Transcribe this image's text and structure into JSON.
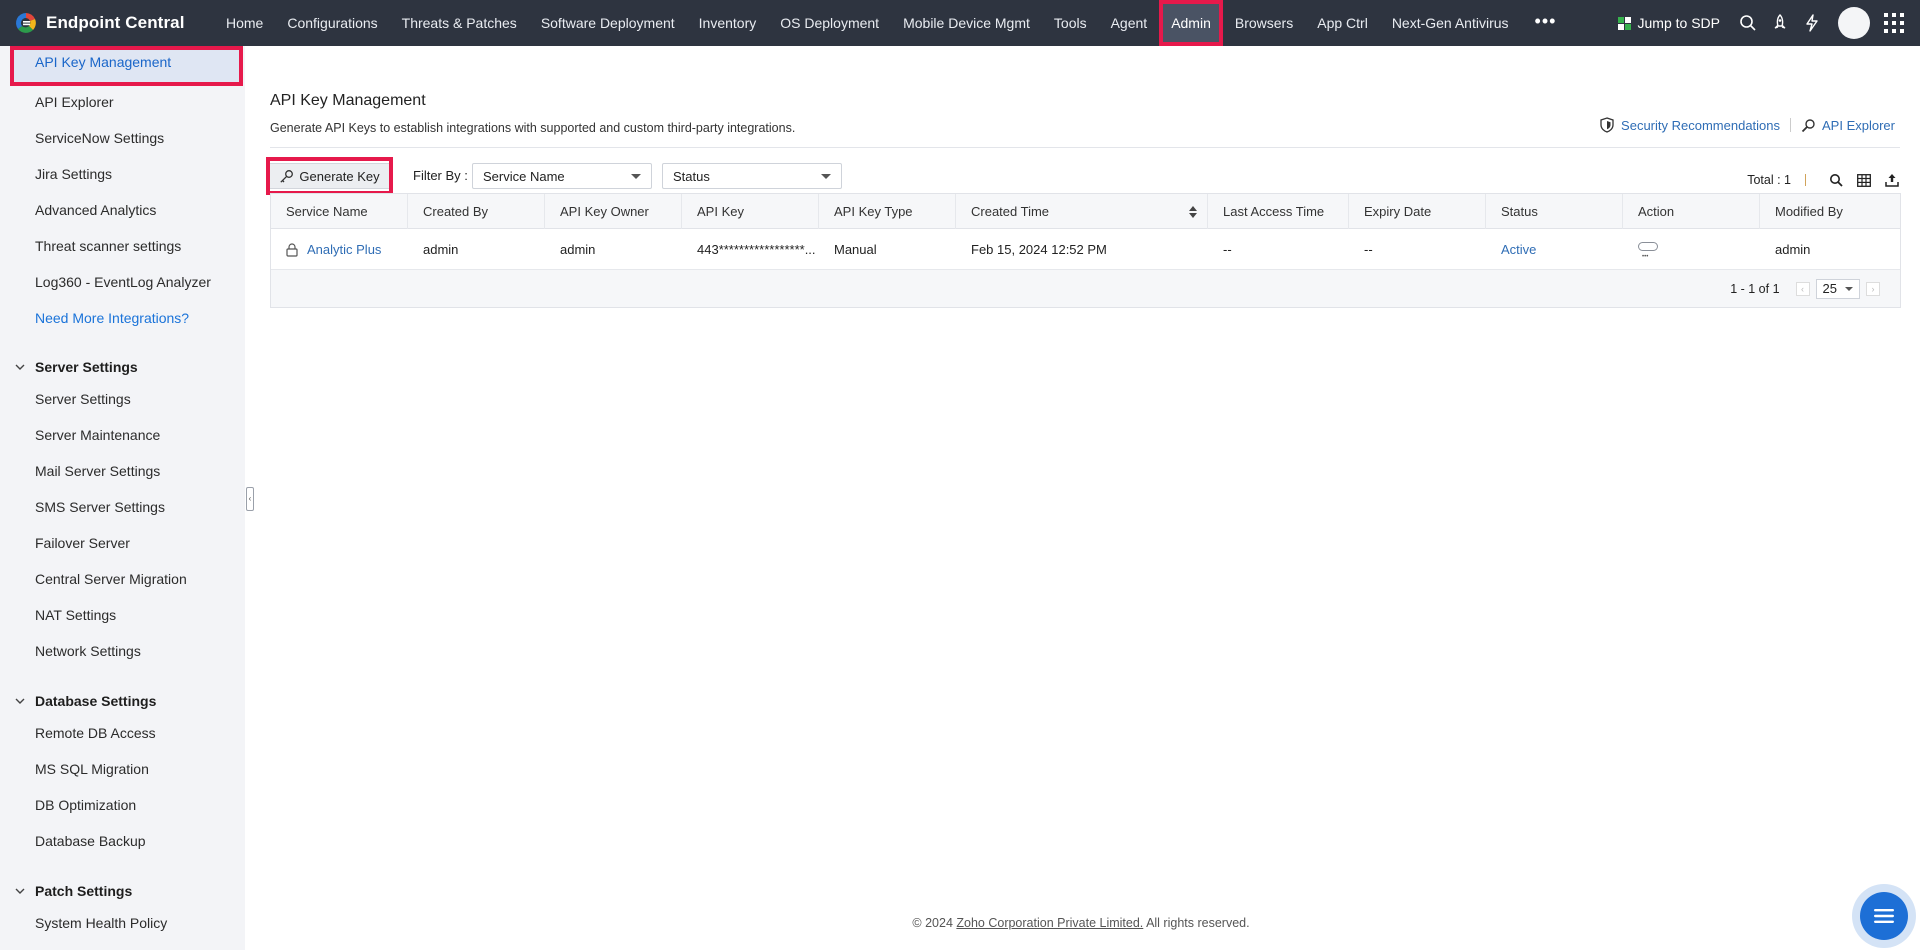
{
  "app": {
    "brand": "Endpoint Central"
  },
  "nav": {
    "items": [
      "Home",
      "Configurations",
      "Threats & Patches",
      "Software Deployment",
      "Inventory",
      "OS Deployment",
      "Mobile Device Mgmt",
      "Tools",
      "Agent",
      "Admin",
      "Browsers",
      "App Ctrl",
      "Next-Gen Antivirus"
    ],
    "active": "Admin",
    "more_icon": "more-horizontal-icon",
    "jump_label": "Jump to SDP",
    "right_icons": [
      "search-icon",
      "rocket-icon",
      "lightning-icon",
      "avatar",
      "apps-grid-icon"
    ]
  },
  "sidebar": {
    "integrations": [
      "API Key Management",
      "API Explorer",
      "ServiceNow Settings",
      "Jira Settings",
      "Advanced Analytics",
      "Threat scanner settings",
      "Log360 - EventLog Analyzer"
    ],
    "need_more": "Need More Integrations?",
    "sections": [
      {
        "title": "Server Settings",
        "items": [
          "Server Settings",
          "Server Maintenance",
          "Mail Server Settings",
          "SMS Server Settings",
          "Failover Server",
          "Central Server Migration",
          "NAT Settings",
          "Network Settings"
        ]
      },
      {
        "title": "Database Settings",
        "items": [
          "Remote DB Access",
          "MS SQL Migration",
          "DB Optimization",
          "Database Backup"
        ]
      },
      {
        "title": "Patch Settings",
        "items": [
          "System Health Policy"
        ]
      }
    ]
  },
  "main": {
    "title": "API Key Management",
    "description": "Generate API Keys to establish integrations with supported and custom third-party integrations.",
    "links": {
      "security": "Security Recommendations",
      "explorer": "API Explorer"
    },
    "generate_label": "Generate Key",
    "filter_label": "Filter By :",
    "filter_service": "Service Name",
    "filter_status": "Status",
    "total_label": "Total : 1"
  },
  "table": {
    "columns": [
      "Service Name",
      "Created By",
      "API Key Owner",
      "API Key",
      "API Key Type",
      "Created Time",
      "Last Access Time",
      "Expiry Date",
      "Status",
      "Action",
      "Modified By"
    ],
    "rows": [
      {
        "service": "Analytic Plus",
        "created_by": "admin",
        "owner": "admin",
        "api_key": "443*****************...",
        "type": "Manual",
        "created_time": "Feb 15, 2024 12:52 PM",
        "last_access": "--",
        "expiry": "--",
        "status": "Active",
        "modified_by": "admin"
      }
    ],
    "pagination": "1 - 1 of 1",
    "per_page": "25"
  },
  "footer": {
    "prefix": "© 2024 ",
    "company": "Zoho Corporation Private Limited.",
    "suffix": " All rights reserved."
  },
  "colors": {
    "nav_bg": "#2e3440",
    "highlight": "#e6194b",
    "link": "#2f6db5",
    "fab": "#1d6fd6"
  }
}
